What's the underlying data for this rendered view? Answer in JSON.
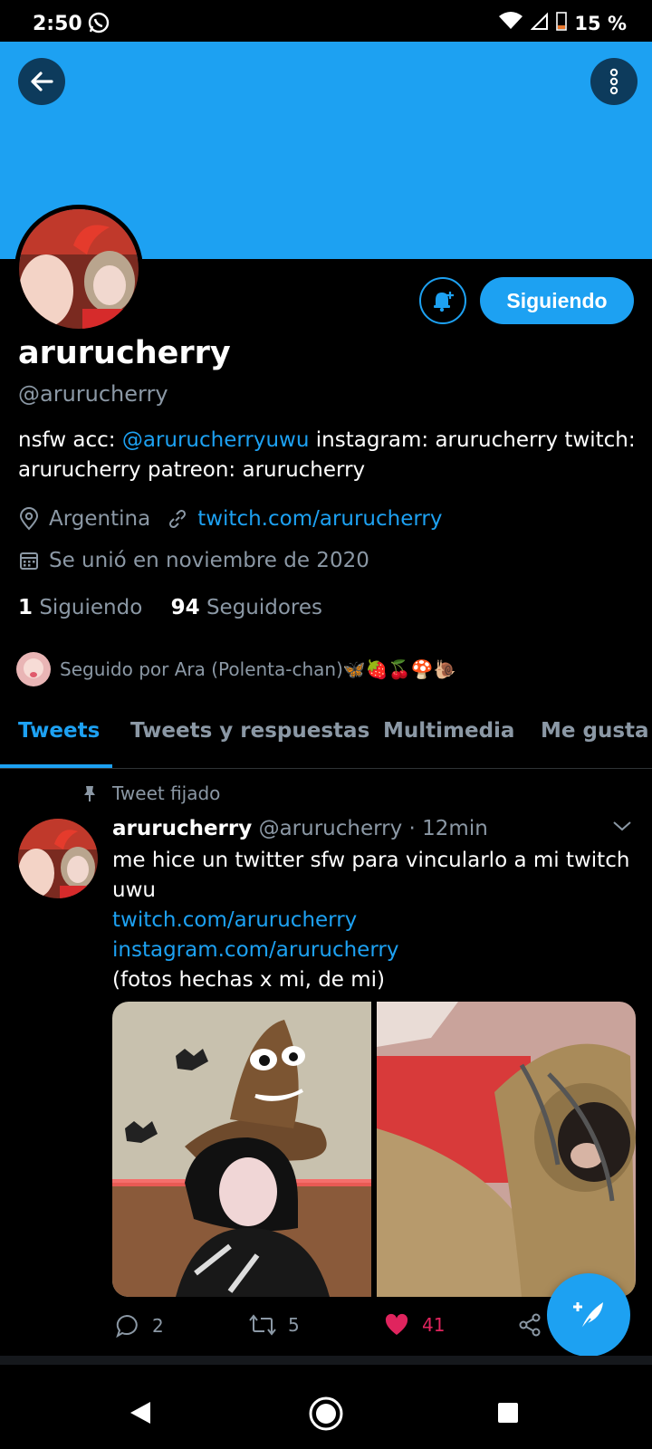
{
  "status": {
    "time": "2:50",
    "battery": "15 %"
  },
  "profile": {
    "display_name": "arurucherry",
    "handle": "@arurucherry",
    "bio_prefix": "nsfw acc: ",
    "bio_mention": "@arurucherryuwu",
    "bio_suffix": " instagram: arurucherry twitch: arurucherry patreon: arurucherry",
    "location": "Argentina",
    "website": "twitch.com/arurucherry",
    "joined": "Se unió en noviembre de 2020",
    "following_count": "1",
    "following_label": "Siguiendo",
    "followers_count": "94",
    "followers_label": "Seguidores",
    "followed_by": "Seguido por Ara (Polenta-chan)",
    "followed_by_emoji": "🦋🍓🍒🍄🐌"
  },
  "buttons": {
    "following": "Siguiendo"
  },
  "tabs": [
    {
      "label": "Tweets"
    },
    {
      "label": "Tweets y respuestas"
    },
    {
      "label": "Multimedia"
    },
    {
      "label": "Me gusta"
    }
  ],
  "tweet": {
    "pinned_label": "Tweet fijado",
    "author_name": "arurucherry",
    "author_handle": "@arurucherry",
    "time": "· 12min",
    "text": "me hice un twitter sfw para vincularlo a mi twitch uwu",
    "link1": "twitch.com/arurucherry",
    "link2": "instagram.com/arurucherry",
    "text2": "(fotos hechas x mi, de mi)",
    "replies": "2",
    "retweets": "5",
    "likes": "41"
  },
  "colors": {
    "accent": "#1da1f2",
    "like": "#e0245e",
    "background": "#000000",
    "muted": "#8b98a5"
  }
}
